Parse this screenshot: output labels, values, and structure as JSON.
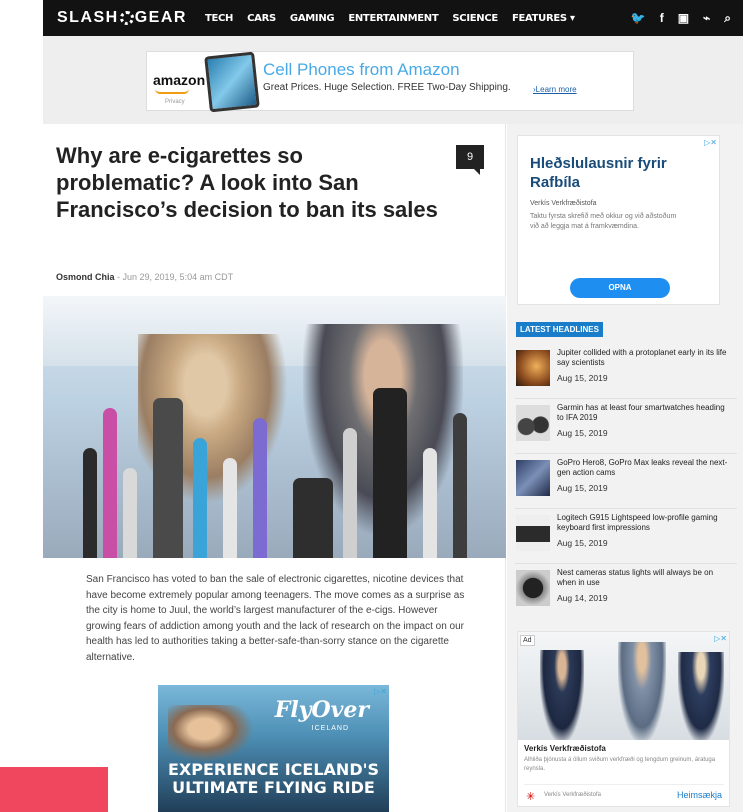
{
  "nav": {
    "logo": "SLASH",
    "logo_end": "GEAR",
    "items": [
      "TECH",
      "CARS",
      "GAMING",
      "ENTERTAINMENT",
      "SCIENCE",
      "FEATURES ▾"
    ],
    "icons": [
      "twitter-icon",
      "facebook-icon",
      "youtube-icon",
      "rss-icon",
      "search-icon"
    ],
    "icon_glyphs": [
      "🐦",
      "f",
      "▣",
      "⌁",
      "⌕"
    ]
  },
  "leaderboard": {
    "brand": "amazon",
    "privacy": "Privacy",
    "headline": "Cell Phones from Amazon",
    "sub": "Great Prices. Huge Selection. FREE Two-Day Shipping.",
    "learn": "›Learn more"
  },
  "article": {
    "title": "Why are e-cigarettes so problematic? A look into San Francisco’s decision to ban its sales",
    "comments": "9",
    "author": "Osmond Chia",
    "date": " - Jun 29, 2019, 5:04 am CDT",
    "body": "San Francisco has voted to ban the sale of electronic cigarettes, nicotine devices that have become extremely popular among teenagers. The move comes as a surprise as the city is home to Juul, the world’s largest manufacturer of the e-cigs. However growing fears of addiction among youth and the lack of research on the impact on our health has led to authorities taking a better-safe-than-sorry stance on the cigarette alternative."
  },
  "inline_ad": {
    "brand": "FlyOver",
    "brand_sub": "ICELAND",
    "headline_1": "EXPERIENCE ICELAND'S",
    "headline_2": "ULTIMATE FLYING RIDE",
    "close": "▷✕"
  },
  "sidebar_ad": {
    "close": "▷✕",
    "headline": "Hleðslulausnir fyrir Rafbíla",
    "company": "Verkís Verkfræðistofa",
    "desc": "Taktu fyrsta skrefið með okkur og við aðstoðum við að leggja mat á framkvæmdina.",
    "button": "OPNA"
  },
  "latest": {
    "label": "LATEST HEADLINES",
    "items": [
      {
        "title": "Jupiter collided with a protoplanet early in its life say scientists",
        "date": "Aug 15, 2019",
        "thumb_color": "#c57a2e"
      },
      {
        "title": "Garmin has at least four smartwatches heading to IFA 2019",
        "date": "Aug 15, 2019",
        "thumb_color": "#3a3a3a"
      },
      {
        "title": "GoPro Hero8, GoPro Max leaks reveal the next-gen action cams",
        "date": "Aug 15, 2019",
        "thumb_color": "#4a5e8a"
      },
      {
        "title": "Logitech G915 Lightspeed low-profile gaming keyboard first impressions",
        "date": "Aug 15, 2019",
        "thumb_color": "#2b2b2b"
      },
      {
        "title": "Nest cameras status lights will always be on when in use",
        "date": "Aug 14, 2019",
        "thumb_color": "#555555"
      }
    ]
  },
  "sidebar_ad2": {
    "badge": "Ad",
    "close": "▷✕",
    "company": "Verkís Verkfræðistofa",
    "desc": "Alhliða þjónusta á öllum sviðum verkfræði og tengdum greinum, áratuga reynsla.",
    "footer_name": "Verkís Verkfræðistofa",
    "footer_button": "Heimsækja"
  },
  "colors": {
    "nav_bg": "#121212",
    "accent_blue": "#1a7dc9",
    "overlay_pink": "#f0475e"
  }
}
